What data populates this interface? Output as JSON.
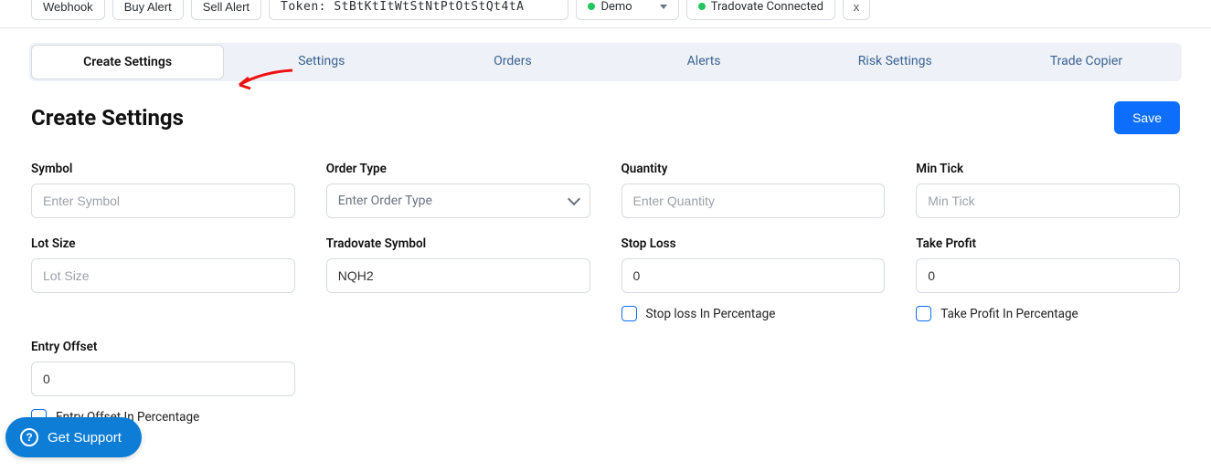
{
  "toolbar": {
    "webhook_label": "Webhook",
    "buy_alert_label": "Buy Alert",
    "sell_alert_label": "Sell Alert",
    "token_label": "Token: StBtKtItWtStNtPtOtStQt4tA",
    "env_select": "Demo",
    "conn_status": "Tradovate Connected",
    "x_label": "x"
  },
  "tabs": [
    "Create Settings",
    "Settings",
    "Orders",
    "Alerts",
    "Risk Settings",
    "Trade Copier"
  ],
  "page": {
    "title": "Create Settings",
    "save_label": "Save"
  },
  "form": {
    "symbol": {
      "label": "Symbol",
      "placeholder": "Enter Symbol"
    },
    "order_type": {
      "label": "Order Type",
      "placeholder": "Enter Order Type"
    },
    "quantity": {
      "label": "Quantity",
      "placeholder": "Enter Quantity"
    },
    "min_tick": {
      "label": "Min Tick",
      "placeholder": "Min Tick"
    },
    "lot_size": {
      "label": "Lot Size",
      "placeholder": "Lot Size"
    },
    "tradovate_symbol": {
      "label": "Tradovate Symbol",
      "value": "NQH2"
    },
    "stop_loss": {
      "label": "Stop Loss",
      "value": "0",
      "checkbox_label": "Stop loss In Percentage"
    },
    "take_profit": {
      "label": "Take Profit",
      "value": "0",
      "checkbox_label": "Take Profit In Percentage"
    },
    "entry_offset": {
      "label": "Entry Offset",
      "value": "0",
      "checkbox_label": "Entry Offset In Percentage"
    }
  },
  "support": {
    "label": "Get Support"
  }
}
